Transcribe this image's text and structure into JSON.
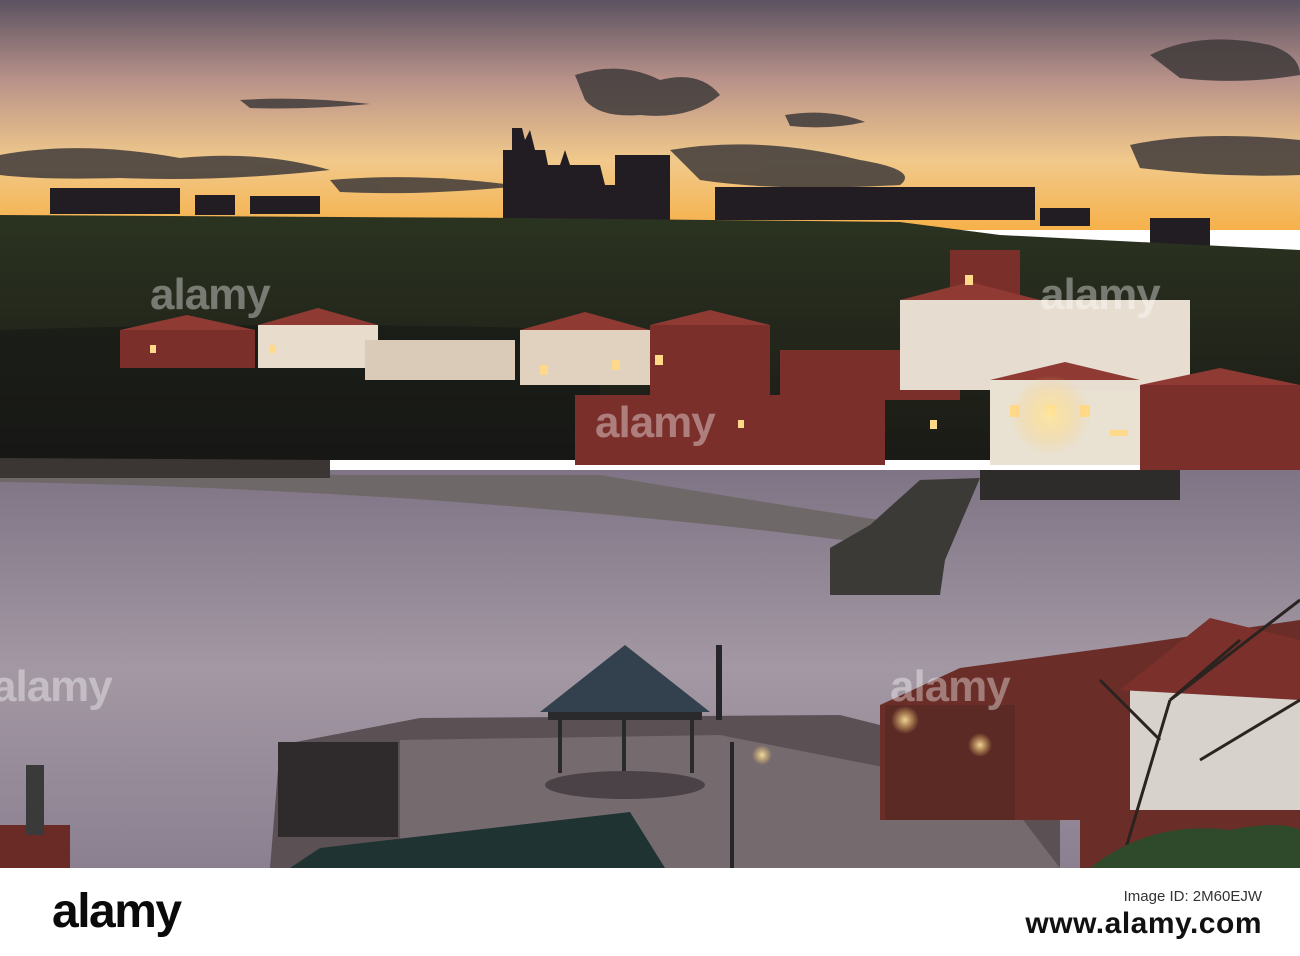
{
  "watermark": {
    "brand": "alamy",
    "repeat_text": "alamy"
  },
  "footer": {
    "brand": "alamy",
    "subtitle": "Image ID: 2M60EJW",
    "image_id": "www.alamy.com"
  },
  "colors": {
    "sky_top": "#5a5060",
    "sunset_glow": "#f3c884",
    "cliff": "#1e2318",
    "water": "#978b96",
    "brick_roof": "#8a2e2a",
    "window_light": "#ffd98a"
  }
}
